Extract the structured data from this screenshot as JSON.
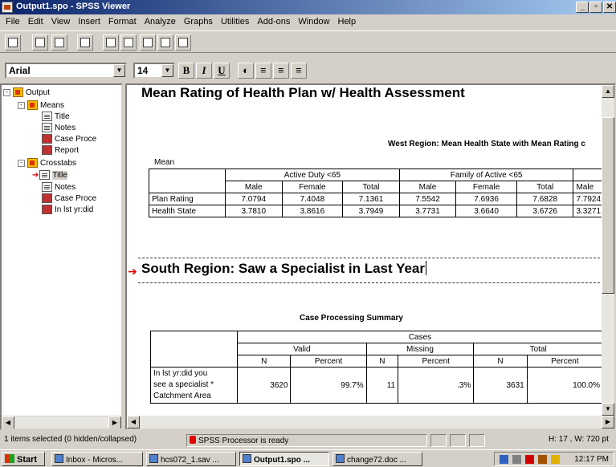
{
  "window": {
    "title": "Output1.spo - SPSS Viewer"
  },
  "menu": [
    "File",
    "Edit",
    "View",
    "Insert",
    "Format",
    "Analyze",
    "Graphs",
    "Utilities",
    "Add-ons",
    "Window",
    "Help"
  ],
  "font_toolbar": {
    "font_name": "Arial",
    "font_size": "14",
    "bold": "B",
    "italic": "I",
    "underline": "U"
  },
  "outline": {
    "output": "Output",
    "means": "Means",
    "means_title": "Title",
    "means_notes": "Notes",
    "means_case": "Case Proce",
    "means_report": "Report",
    "crosstabs": "Crosstabs",
    "cross_title": "Title",
    "cross_notes": "Notes",
    "cross_case": "Case Proce",
    "cross_inlst": "In lst yr:did"
  },
  "content": {
    "heading1": "Mean Rating of Health Plan w/ Health Assessment",
    "west_title": "West Region: Mean Health State with Mean Rating c",
    "layer": "Mean",
    "west_table": {
      "groups": [
        "Active Duty <65",
        "Family of Active <65",
        "Re"
      ],
      "cols": [
        "Male",
        "Female",
        "Total",
        "Male",
        "Female",
        "Total",
        "Male"
      ],
      "rows": [
        {
          "label": "Plan Rating",
          "values": [
            "7.0794",
            "7.4048",
            "7.1361",
            "7.5542",
            "7.6936",
            "7.6828",
            "7.7924"
          ]
        },
        {
          "label": "Health State",
          "values": [
            "3.7810",
            "3.8616",
            "3.7949",
            "3.7731",
            "3.6640",
            "3.6726",
            "3.3271"
          ]
        }
      ]
    },
    "heading2": "South Region: Saw a Specialist in Last Year",
    "cps_title": "Case Processing Summary",
    "cps": {
      "cases": "Cases",
      "groups": [
        "Valid",
        "Missing",
        "Total"
      ],
      "cols": [
        "N",
        "Percent",
        "N",
        "Percent",
        "N",
        "Percent"
      ],
      "row_label": [
        "In lst yr:did you",
        "see a specialist *",
        "Catchment Area"
      ],
      "values": [
        "3620",
        "99.7%",
        "11",
        ".3%",
        "3631",
        "100.0%"
      ]
    }
  },
  "status": {
    "selection": "1 items selected (0 hidden/collapsed)",
    "processor": "SPSS Processor  is ready",
    "dims": "H: 17 , W: 720 pt"
  },
  "taskbar": {
    "start": "Start",
    "tasks": [
      "Inbox - Micros...",
      "hcs072_1.sav ...",
      "Output1.spo ...",
      "change72.doc ..."
    ],
    "clock": "12:17 PM"
  }
}
